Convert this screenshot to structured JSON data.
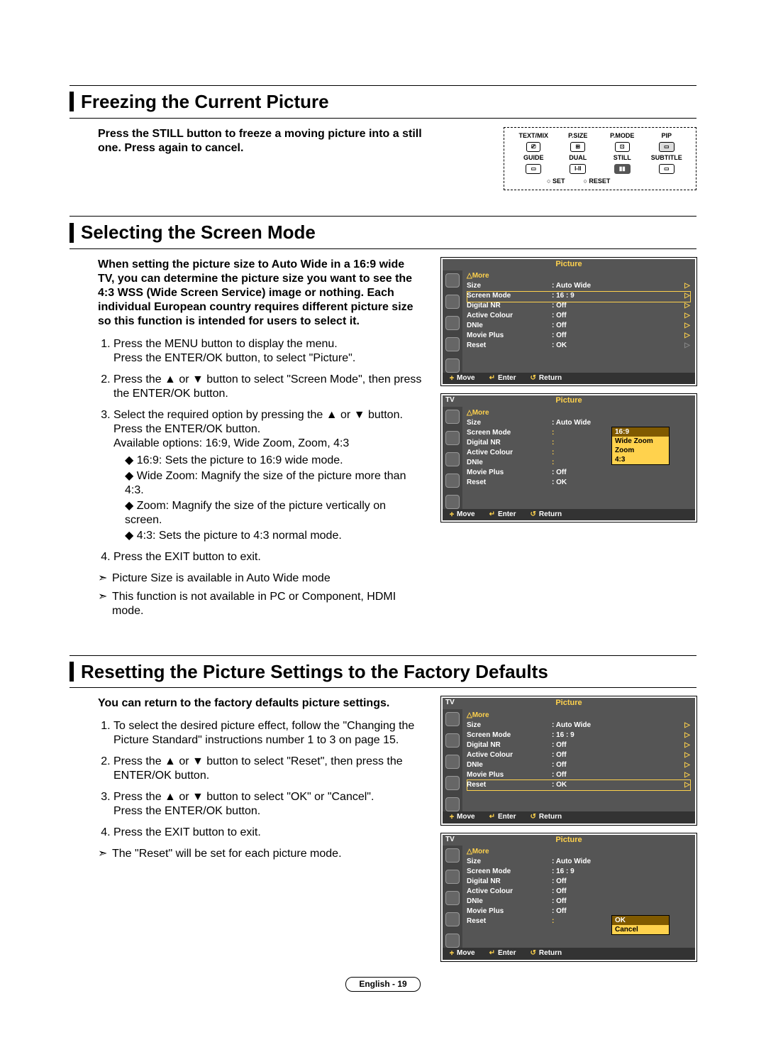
{
  "page_footer": "English - 19",
  "sections": {
    "s1": {
      "title": "Freezing the Current Picture",
      "intro": "Press the STILL button to freeze a moving picture into a still one. Press again to cancel."
    },
    "s2": {
      "title": "Selecting the Screen Mode",
      "intro": "When setting the picture size to Auto Wide in a 16:9 wide TV, you can determine the picture size you want to see the 4:3 WSS (Wide Screen Service) image or nothing. Each individual European country requires different picture size so this function is intended for users to select it.",
      "steps": {
        "s1a": "Press the MENU button to display the menu.",
        "s1b": "Press the ENTER/OK button, to select \"Picture\".",
        "s2": "Press the ▲ or ▼ button to select \"Screen Mode\", then press the ENTER/OK button.",
        "s3a": "Select the required option by pressing the ▲ or ▼ button.",
        "s3b": "Press the ENTER/OK button.",
        "s3c": "Available options: 16:9, Wide Zoom, Zoom, 4:3",
        "s3d": "◆ 16:9: Sets the picture to 16:9 wide mode.",
        "s3e": "◆ Wide Zoom: Magnify the size of the picture more than 4:3.",
        "s3f": "◆ Zoom: Magnify the size of the picture vertically on screen.",
        "s3g": "◆ 4:3: Sets the picture to 4:3 normal mode.",
        "s4": "Press the EXIT button to exit."
      },
      "notes": {
        "n1": "Picture Size is available in Auto Wide mode",
        "n2": "This function is not available in PC or Component, HDMI mode."
      }
    },
    "s3": {
      "title": "Resetting the Picture Settings to the Factory Defaults",
      "intro": "You can return to the factory defaults picture settings.",
      "steps": {
        "s1": "To select the desired picture effect, follow the \"Changing the Picture Standard\" instructions number 1 to 3 on page 15.",
        "s2": "Press the ▲ or ▼ button to select \"Reset\", then press the ENTER/OK button.",
        "s3a": "Press the ▲ or ▼ button to select \"OK\" or \"Cancel\".",
        "s3b": "Press the ENTER/OK button.",
        "s4": "Press the EXIT button to exit."
      },
      "notes": {
        "n1": "The \"Reset\" will be set for each picture mode."
      }
    }
  },
  "remote": {
    "r1": [
      "TEXT/MIX",
      "P.SIZE",
      "P.MODE",
      "PIP"
    ],
    "r2": [
      "GUIDE",
      "DUAL",
      "STILL",
      "SUBTITLE"
    ],
    "bottom": [
      "SET",
      "RESET"
    ]
  },
  "osd": {
    "tv": "TV",
    "title": "Picture",
    "more": "△More",
    "rows": [
      {
        "k": "Size",
        "v": ": Auto Wide"
      },
      {
        "k": "Screen Mode",
        "v": ": 16 : 9"
      },
      {
        "k": "Digital NR",
        "v": ": Off"
      },
      {
        "k": "Active Colour",
        "v": ": Off"
      },
      {
        "k": "DNIe",
        "v": ": Off"
      },
      {
        "k": "Movie Plus",
        "v": ": Off"
      },
      {
        "k": "Reset",
        "v": ": OK"
      }
    ],
    "foot": {
      "a": "Move",
      "b": "Enter",
      "c": "Return"
    },
    "dd_screen": [
      "16:9",
      "Wide Zoom",
      "Zoom",
      "4:3"
    ],
    "dd_reset": [
      "OK",
      "Cancel"
    ]
  }
}
